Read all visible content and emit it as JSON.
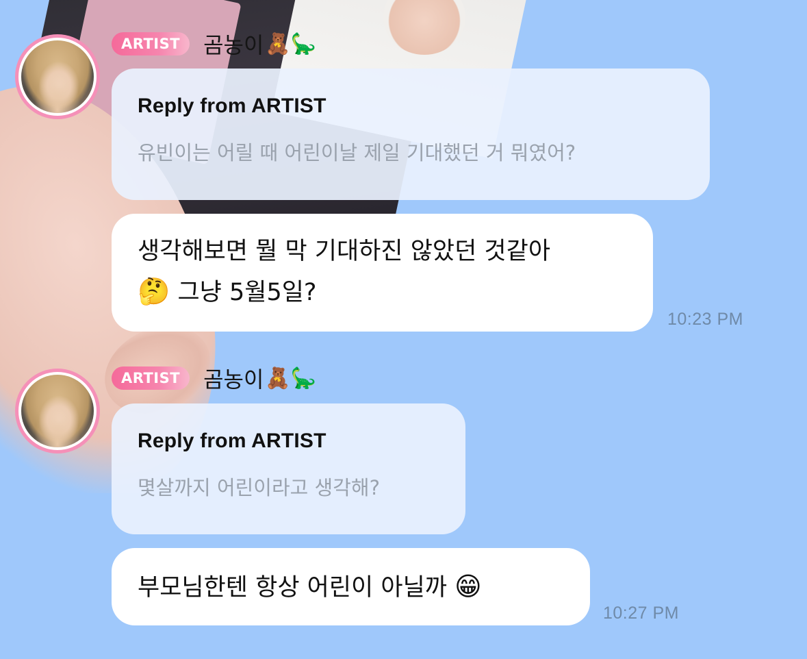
{
  "messages": [
    {
      "badge": "ARTIST",
      "nickname": "곰농이",
      "nickname_emojis": "🧸🦕",
      "reply_title": "Reply from ARTIST",
      "reply_question": "유빈이는 어릴 때 어린이날 제일 기대했던 거 뭐였어?",
      "answer_line1": "생각해보면 뭘 막 기대하진 않았던 것같아",
      "answer_emoji": "🤔",
      "answer_line2": "그냥 5월5일?",
      "time": "10:23 PM"
    },
    {
      "badge": "ARTIST",
      "nickname": "곰농이",
      "nickname_emojis": "🧸🦕",
      "reply_title": "Reply from ARTIST",
      "reply_question": "몇살까지 어린이라고 생각해?",
      "answer_text": "부모님한텐 항상 어린이 아닐까",
      "answer_emoji": "😁",
      "time": "10:27 PM"
    }
  ],
  "colors": {
    "background": "#9fc8fb",
    "badge": "#f56a9a",
    "avatar_ring": "#f590b8",
    "timestamp": "#6f8aa8"
  }
}
